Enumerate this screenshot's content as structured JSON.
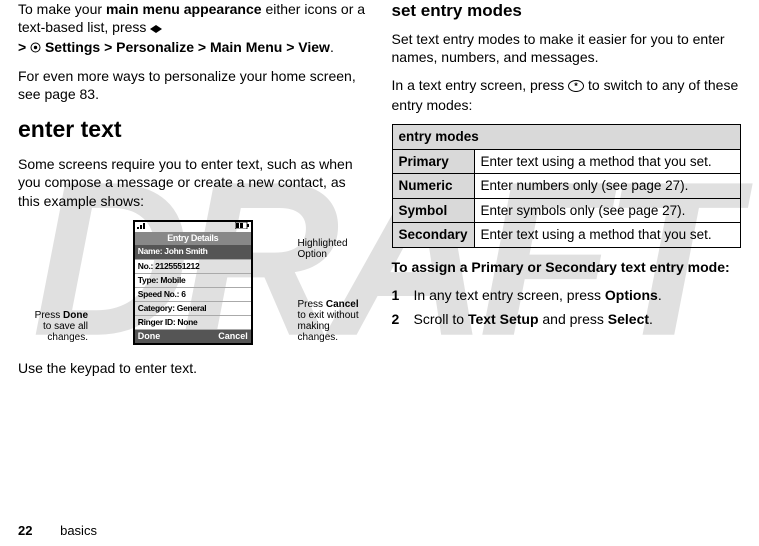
{
  "draft_watermark": "DRAFT",
  "left": {
    "intro_1a": "To make your ",
    "intro_bold": "main menu appearance",
    "intro_1b": " either icons or a text-based list, press ",
    "path_settings": "Settings",
    "path_personalize": "Personalize",
    "path_mainmenu": "Main Menu",
    "path_view": "View",
    "gt": ">",
    "intro_2": "For even more ways to personalize your home screen, see page 83.",
    "heading": "enter text",
    "body1": "Some screens require you to enter text, such as when you compose a message or create a new contact, as this example shows:",
    "body2": "Use the keypad to enter text."
  },
  "phone": {
    "title": "Entry Details",
    "rows": {
      "name": "Name: John Smith",
      "no": "No.: 2125551212",
      "type": "Type: Mobile",
      "speed": "Speed No.: 6",
      "category": "Category: General",
      "ringer": "Ringer ID: None"
    },
    "soft_left": "Done",
    "soft_right": "Cancel",
    "callouts": {
      "done_1": "Press ",
      "done_bold": "Done",
      "done_2": " to save all changes.",
      "hl": "Highlighted Option",
      "cancel_1": "Press ",
      "cancel_bold": "Cancel",
      "cancel_2": " to exit without making changes."
    }
  },
  "right": {
    "heading": "set entry modes",
    "body1": "Set text entry modes to make it easier for you to enter names, numbers, and messages.",
    "body2a": "In a text entry screen, press ",
    "body2b": " to switch to any of these entry modes:",
    "table": {
      "header": "entry modes",
      "rows": [
        {
          "label": "Primary",
          "desc": "Enter text using a method that you set."
        },
        {
          "label": "Numeric",
          "desc": "Enter numbers only (see page 27)."
        },
        {
          "label": "Symbol",
          "desc": "Enter symbols only (see page 27)."
        },
        {
          "label": "Secondary",
          "desc": "Enter text using a method that you set."
        }
      ]
    },
    "assign_heading": "To assign a Primary or Secondary text entry mode:",
    "steps": [
      {
        "n": "1",
        "a": "In any text entry screen, press ",
        "b1": "Options",
        "c": "."
      },
      {
        "n": "2",
        "a": "Scroll to ",
        "b1": "Text Setup",
        "mid": " and press ",
        "b2": "Select",
        "c": "."
      }
    ]
  },
  "footer": {
    "page": "22",
    "section": "basics"
  }
}
